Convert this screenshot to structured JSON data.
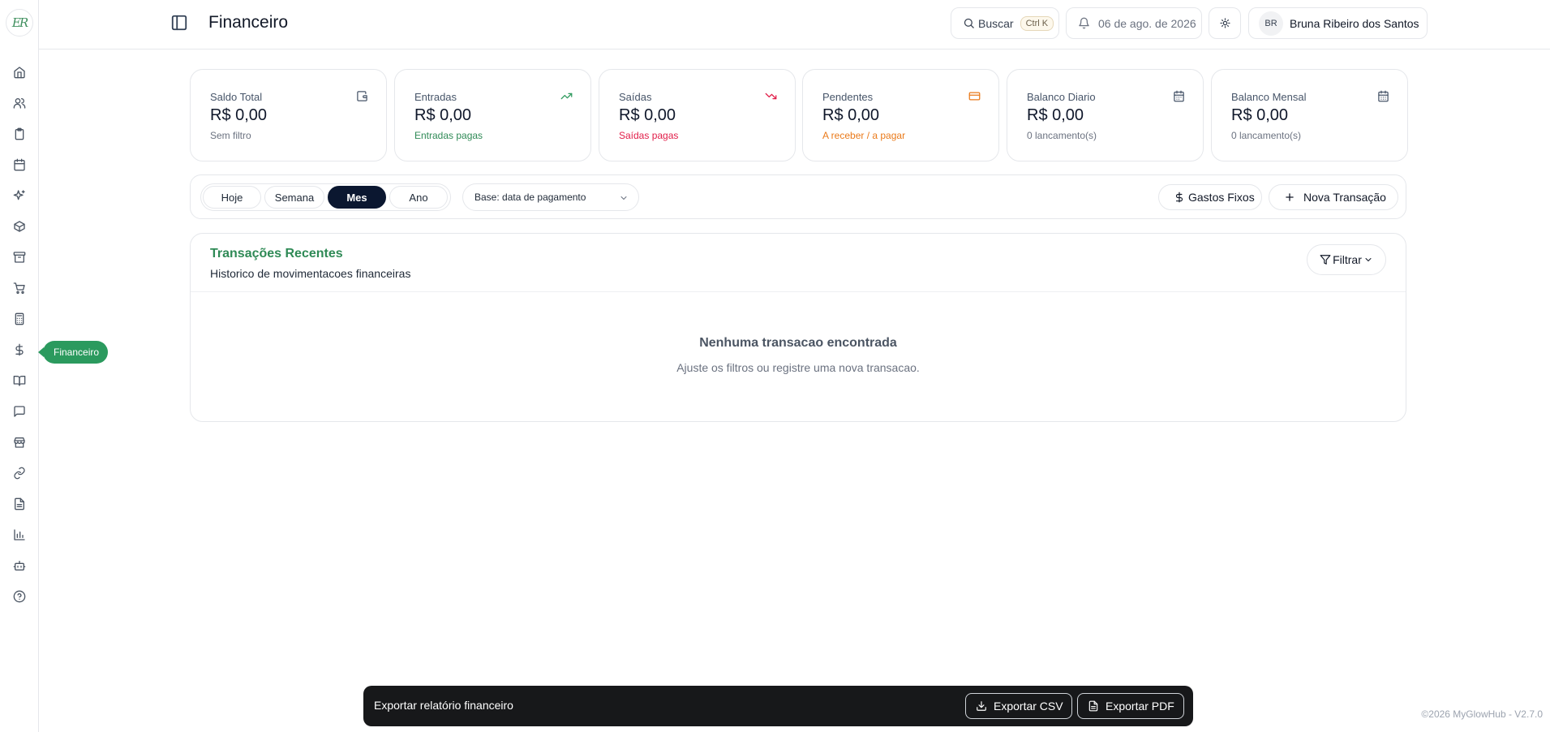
{
  "app": {
    "logo_text": "ER"
  },
  "sidebar": {
    "items": [
      {
        "icon": "home-icon"
      },
      {
        "icon": "users-icon"
      },
      {
        "icon": "clipboard-icon"
      },
      {
        "icon": "calendar-icon"
      },
      {
        "icon": "sparkles-icon"
      },
      {
        "icon": "package-icon"
      },
      {
        "icon": "archive-icon"
      },
      {
        "icon": "cart-icon"
      },
      {
        "icon": "calculator-icon"
      },
      {
        "icon": "dollar-icon",
        "active": true
      },
      {
        "icon": "book-icon"
      },
      {
        "icon": "chat-icon"
      },
      {
        "icon": "store-icon"
      },
      {
        "icon": "link-icon"
      },
      {
        "icon": "document-icon"
      },
      {
        "icon": "bar-chart-icon"
      },
      {
        "icon": "robot-icon"
      },
      {
        "icon": "help-icon"
      }
    ],
    "tooltip": "Financeiro"
  },
  "header": {
    "title": "Financeiro",
    "search_label": "Buscar",
    "search_shortcut": "Ctrl K",
    "date": "06 de ago. de 2026",
    "user_initials": "BR",
    "user_name": "Bruna Ribeiro dos Santos"
  },
  "cards": [
    {
      "label": "Saldo Total",
      "value": "R$ 0,00",
      "sub": "Sem filtro",
      "sub_color": "#6b7280",
      "icon": "wallet-icon",
      "icon_color": "#475569"
    },
    {
      "label": "Entradas",
      "value": "R$ 0,00",
      "sub": "Entradas pagas",
      "sub_color": "#2f8a56",
      "icon": "trending-up-icon",
      "icon_color": "#2f9a5e"
    },
    {
      "label": "Saídas",
      "value": "R$ 0,00",
      "sub": "Saídas pagas",
      "sub_color": "#e11d48",
      "icon": "trending-down-icon",
      "icon_color": "#e11d48"
    },
    {
      "label": "Pendentes",
      "value": "R$ 0,00",
      "sub": "A receber / a pagar",
      "sub_color": "#ea7a1a",
      "icon": "credit-card-icon",
      "icon_color": "#ea7a1a"
    },
    {
      "label": "Balanco Diario",
      "value": "R$ 0,00",
      "sub": "0 lancamento(s)",
      "sub_color": "#6b7280",
      "icon": "calendar-icon",
      "icon_color": "#475569"
    },
    {
      "label": "Balanco Mensal",
      "value": "R$ 0,00",
      "sub": "0 lancamento(s)",
      "sub_color": "#6b7280",
      "icon": "calendar-icon",
      "icon_color": "#475569"
    }
  ],
  "filters": {
    "periods": [
      {
        "label": "Hoje",
        "active": false
      },
      {
        "label": "Semana",
        "active": false
      },
      {
        "label": "Mes",
        "active": true
      },
      {
        "label": "Ano",
        "active": false
      }
    ],
    "base_select": "Base: data de pagamento",
    "fixed_costs_label": "Gastos Fixos",
    "new_transaction_label": "Nova Transação"
  },
  "transactions": {
    "title": "Transações Recentes",
    "subtitle": "Historico de movimentacoes financeiras",
    "filter_label": "Filtrar",
    "empty_title": "Nenhuma transacao encontrada",
    "empty_sub": "Ajuste os filtros ou registre uma nova transacao."
  },
  "export": {
    "label": "Exportar relatório financeiro",
    "csv_label": "Exportar CSV",
    "pdf_label": "Exportar PDF"
  },
  "footer": "©2026 MyGlowHub - V2.7.0",
  "colors": {
    "accent": "#2b9a5e",
    "dark": "#0b1730"
  }
}
